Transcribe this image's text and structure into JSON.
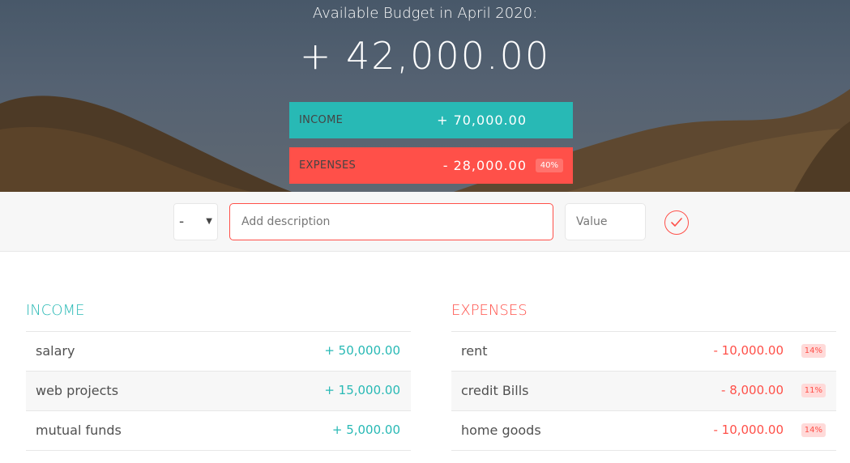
{
  "header": {
    "title": "Available Budget in April 2020:",
    "budget": "+ 42,000.00"
  },
  "summary": {
    "income": {
      "label": "Income",
      "value": "+ 70,000.00"
    },
    "expenses": {
      "label": "Expenses",
      "value": "- 28,000.00",
      "percentage": "40%"
    }
  },
  "add": {
    "type_value": "-",
    "description_placeholder": "Add description",
    "value_placeholder": "Value",
    "submit_icon": "check-circle-icon"
  },
  "income": {
    "title": "Income",
    "items": [
      {
        "description": "salary",
        "value": "+ 50,000.00"
      },
      {
        "description": "web projects",
        "value": "+ 15,000.00"
      },
      {
        "description": "mutual funds",
        "value": "+ 5,000.00"
      }
    ]
  },
  "expenses": {
    "title": "Expenses",
    "items": [
      {
        "description": "rent",
        "value": "- 10,000.00",
        "percentage": "14%"
      },
      {
        "description": "credit Bills",
        "value": "- 8,000.00",
        "percentage": "11%"
      },
      {
        "description": "home goods",
        "value": "- 10,000.00",
        "percentage": "14%"
      }
    ]
  },
  "colors": {
    "income": "#28B9B5",
    "expense": "#FF5049"
  }
}
